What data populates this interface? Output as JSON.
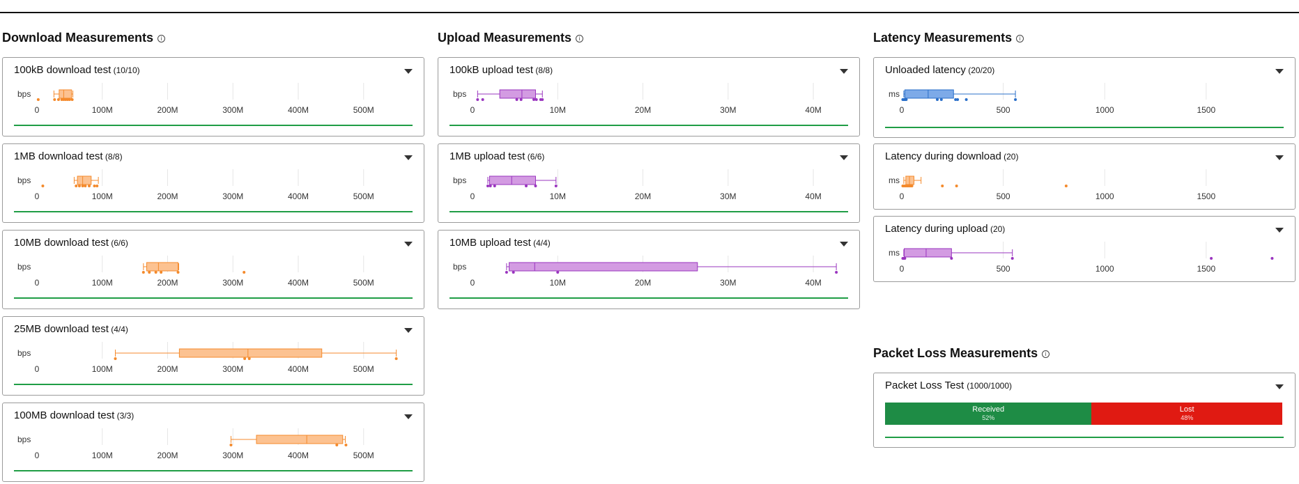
{
  "colors": {
    "download": "#f48a2c",
    "download_fill": "#fcc291",
    "upload": "#9a35bf",
    "upload_fill": "#d39be2",
    "latency": "#2a6fc9",
    "latency_fill": "#7daae8",
    "latency_dl": "#f48a2c",
    "latency_ul": "#9a35bf",
    "received": "#1e8c45",
    "lost": "#e01a12",
    "green_line": "#1f9d45"
  },
  "download": {
    "title": "Download Measurements",
    "info_icon": "info-circle-icon",
    "unit": "bps",
    "ticks": [
      "0",
      "100M",
      "200M",
      "300M",
      "400M",
      "500M"
    ],
    "tick_values": [
      0,
      100,
      200,
      300,
      400,
      500
    ],
    "range": [
      0,
      560
    ],
    "tests": [
      {
        "name": "100kB download test",
        "count": "(10/10)",
        "box": [
          34,
          41,
          53
        ],
        "whisk": [
          26,
          55
        ],
        "points": [
          2,
          27,
          33,
          38,
          41,
          44,
          47,
          50,
          54
        ]
      },
      {
        "name": "1MB download test",
        "count": "(8/8)",
        "box": [
          62,
          70,
          83
        ],
        "whisk": [
          57,
          94
        ],
        "points": [
          9,
          60,
          65,
          70,
          74,
          80,
          88,
          92
        ]
      },
      {
        "name": "10MB download test",
        "count": "(6/6)",
        "box": [
          168,
          186,
          216
        ],
        "whisk": [
          163,
          217
        ],
        "points": [
          163,
          172,
          182,
          190,
          216,
          317
        ]
      },
      {
        "name": "25MB download test",
        "count": "(4/4)",
        "box": [
          218,
          323,
          436
        ],
        "whisk": [
          120,
          550
        ],
        "points": [
          120,
          318,
          325,
          550
        ]
      },
      {
        "name": "100MB download test",
        "count": "(3/3)",
        "box": [
          336,
          413,
          468
        ],
        "whisk": [
          297,
          472
        ],
        "points": [
          297,
          459,
          473
        ]
      }
    ]
  },
  "upload": {
    "title": "Upload Measurements",
    "info_icon": "info-circle-icon",
    "unit": "bps",
    "ticks": [
      "0",
      "10M",
      "20M",
      "30M",
      "40M"
    ],
    "tick_values": [
      0,
      10,
      20,
      30,
      40
    ],
    "range": [
      0,
      44
    ],
    "tests": [
      {
        "name": "100kB upload test",
        "count": "(8/8)",
        "box": [
          3.2,
          5.8,
          7.4
        ],
        "whisk": [
          0.6,
          8.2
        ],
        "points": [
          0.6,
          1.2,
          5.2,
          5.7,
          7.2,
          7.5,
          8.0,
          8.2
        ]
      },
      {
        "name": "1MB upload test",
        "count": "(6/6)",
        "box": [
          2.0,
          4.6,
          7.4
        ],
        "whisk": [
          1.8,
          9.8
        ],
        "points": [
          1.8,
          2.1,
          2.6,
          6.3,
          7.4,
          9.8
        ]
      },
      {
        "name": "10MB upload test",
        "count": "(4/4)",
        "box": [
          4.3,
          7.3,
          26.4
        ],
        "whisk": [
          4.0,
          42.7
        ],
        "points": [
          4.0,
          4.8,
          10.0,
          42.7
        ]
      }
    ]
  },
  "latency": {
    "title": "Latency Measurements",
    "info_icon": "info-circle-icon",
    "unit": "ms",
    "ticks": [
      "0",
      "500",
      "1000",
      "1500"
    ],
    "tick_values": [
      0,
      500,
      1000,
      1500
    ],
    "range": [
      0,
      1875
    ],
    "tests": [
      {
        "name": "Unloaded latency",
        "count": "(20/20)",
        "box": [
          15,
          130,
          255
        ],
        "whisk": [
          10,
          560
        ],
        "points": [
          5,
          8,
          12,
          15,
          18,
          22,
          175,
          195,
          265,
          275,
          318,
          560
        ],
        "kind": "latency"
      },
      {
        "name": "Latency during download",
        "count": "(20)",
        "box": [
          20,
          38,
          60
        ],
        "whisk": [
          10,
          95
        ],
        "points": [
          5,
          10,
          15,
          20,
          25,
          30,
          35,
          40,
          45,
          50,
          200,
          270,
          810
        ],
        "kind": "dl"
      },
      {
        "name": "Latency during upload",
        "count": "(20)",
        "box": [
          12,
          120,
          245
        ],
        "whisk": [
          10,
          545
        ],
        "points": [
          5,
          10,
          15,
          245,
          545,
          1525,
          1825
        ],
        "kind": "ul"
      }
    ]
  },
  "packet": {
    "title": "Packet Loss Measurements",
    "info_icon": "info-circle-icon",
    "test_name": "Packet Loss Test",
    "count": "(1000/1000)",
    "received_label": "Received",
    "received_pct": "52%",
    "received_frac": 0.52,
    "lost_label": "Lost",
    "lost_pct": "48%"
  }
}
